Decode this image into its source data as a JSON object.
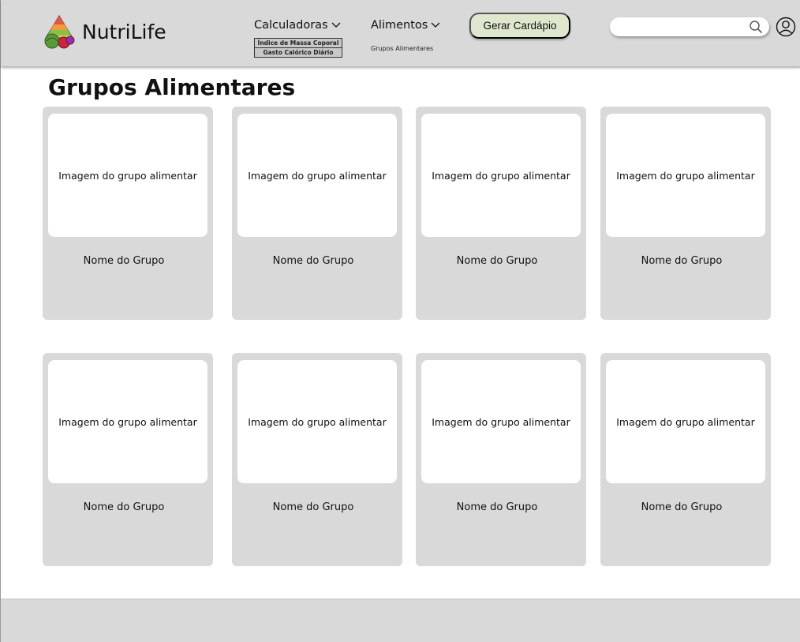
{
  "brand": {
    "name": "NutriLife",
    "logo_icon": "food-pyramid-icon"
  },
  "nav": {
    "calculadoras": {
      "label": "Calculadoras",
      "items": [
        "Índice de Massa Coporal",
        "Gasto Calórico Diário"
      ]
    },
    "alimentos": {
      "label": "Alimentos",
      "items": [
        "Grupos Alimentares"
      ]
    },
    "cta_label": "Gerar Cardápio"
  },
  "search": {
    "placeholder": "",
    "icon": "search-icon"
  },
  "user_icon": "user-icon",
  "page": {
    "title": "Grupos Alimentares"
  },
  "cards": [
    {
      "image_text": "Imagem do grupo alimentar",
      "name": "Nome do Grupo"
    },
    {
      "image_text": "Imagem do grupo alimentar",
      "name": "Nome do Grupo"
    },
    {
      "image_text": "Imagem do grupo alimentar",
      "name": "Nome do Grupo"
    },
    {
      "image_text": "Imagem do grupo alimentar",
      "name": "Nome do Grupo"
    },
    {
      "image_text": "Imagem do grupo alimentar",
      "name": "Nome do Grupo"
    },
    {
      "image_text": "Imagem do grupo alimentar",
      "name": "Nome do Grupo"
    },
    {
      "image_text": "Imagem do grupo alimentar",
      "name": "Nome do Grupo"
    },
    {
      "image_text": "Imagem do grupo alimentar",
      "name": "Nome do Grupo"
    }
  ],
  "colors": {
    "header_bg": "#d9d9d9",
    "cta_bg": "#dfe8cf",
    "card_bg": "#d9d9d9",
    "footer_bg": "#d9d9d9"
  }
}
